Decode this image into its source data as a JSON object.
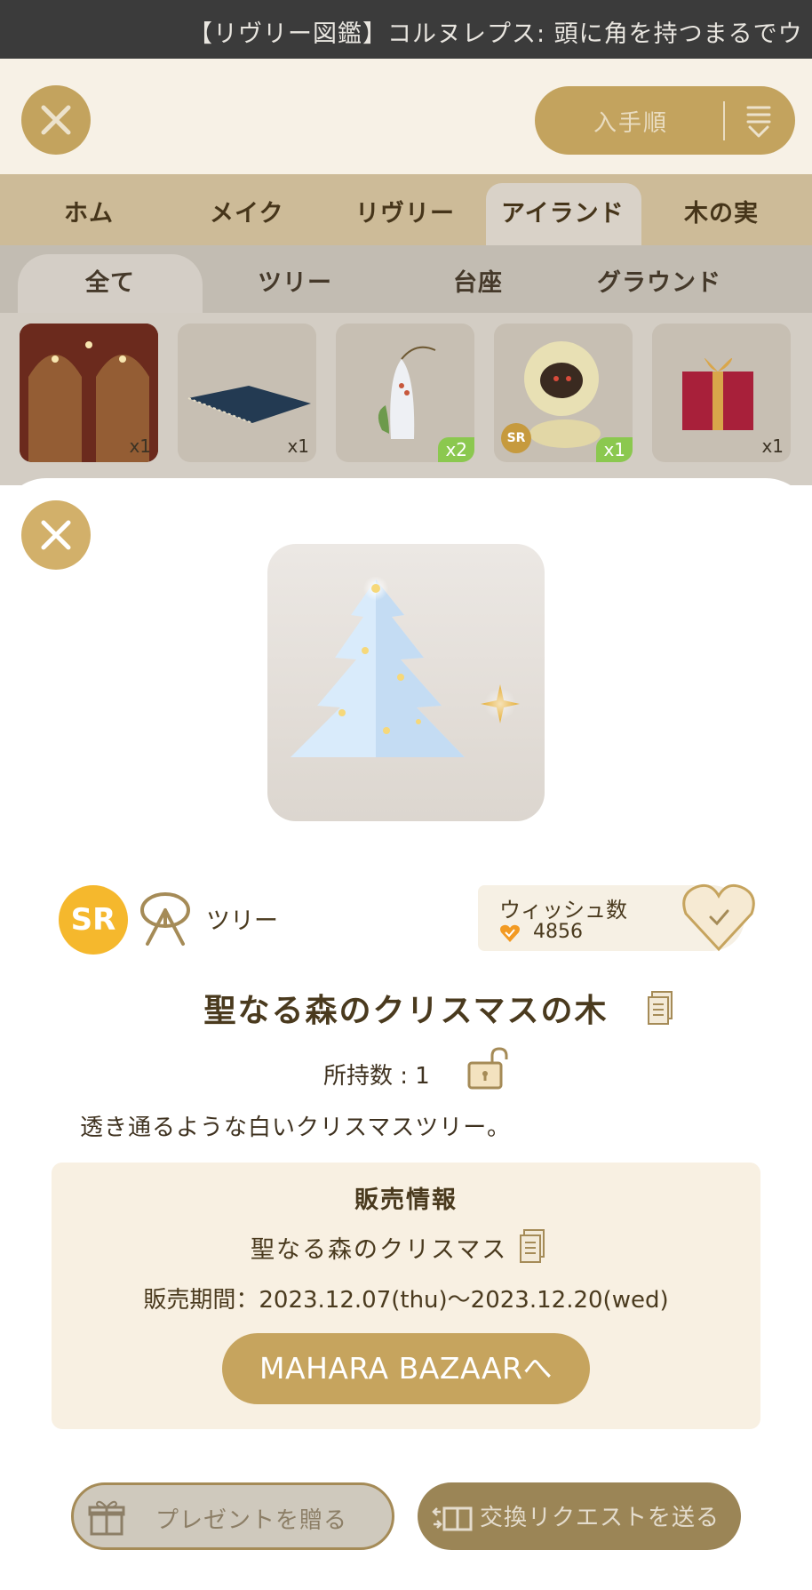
{
  "ticker": {
    "text": "【リヴリー図鑑】コルヌレプス: 頭に角を持つまるでウ"
  },
  "header": {
    "sort_label": "入手順"
  },
  "category_tabs": [
    {
      "label": "ホム",
      "active": false
    },
    {
      "label": "メイク",
      "active": false
    },
    {
      "label": "リヴリー",
      "active": false
    },
    {
      "label": "アイランド",
      "active": true
    },
    {
      "label": "木の実",
      "active": false
    }
  ],
  "sub_tabs": [
    {
      "label": "全て",
      "active": true
    },
    {
      "label": "ツリー",
      "active": false
    },
    {
      "label": "台座",
      "active": false
    },
    {
      "label": "グラウンド",
      "active": false
    }
  ],
  "items": [
    {
      "count": "x1"
    },
    {
      "count": "x1"
    },
    {
      "count": "x2"
    },
    {
      "count": "x1",
      "rarity": "SR"
    },
    {
      "count": "x1"
    }
  ],
  "detail": {
    "rarity": "SR",
    "type_label": "ツリー",
    "wish_title": "ウィッシュ数",
    "wish_count": "4856",
    "name": "聖なる森のクリスマスの木",
    "owned": "所持数 : 1",
    "description": "透き通るような白いクリスマスツリー。"
  },
  "sale_info": {
    "heading": "販売情報",
    "event": "聖なる森のクリスマス",
    "period": "販売期間：2023.12.07(thu)～2023.12.20(wed)",
    "button": "MAHARA BAZAARへ"
  },
  "actions": {
    "present": "プレゼントを贈る",
    "exchange": "交換リクエストを送る"
  },
  "colors": {
    "accent_gold": "#c6a45e",
    "rarity_sr": "#f5b82d",
    "sale_bg": "#f8f0e2"
  }
}
